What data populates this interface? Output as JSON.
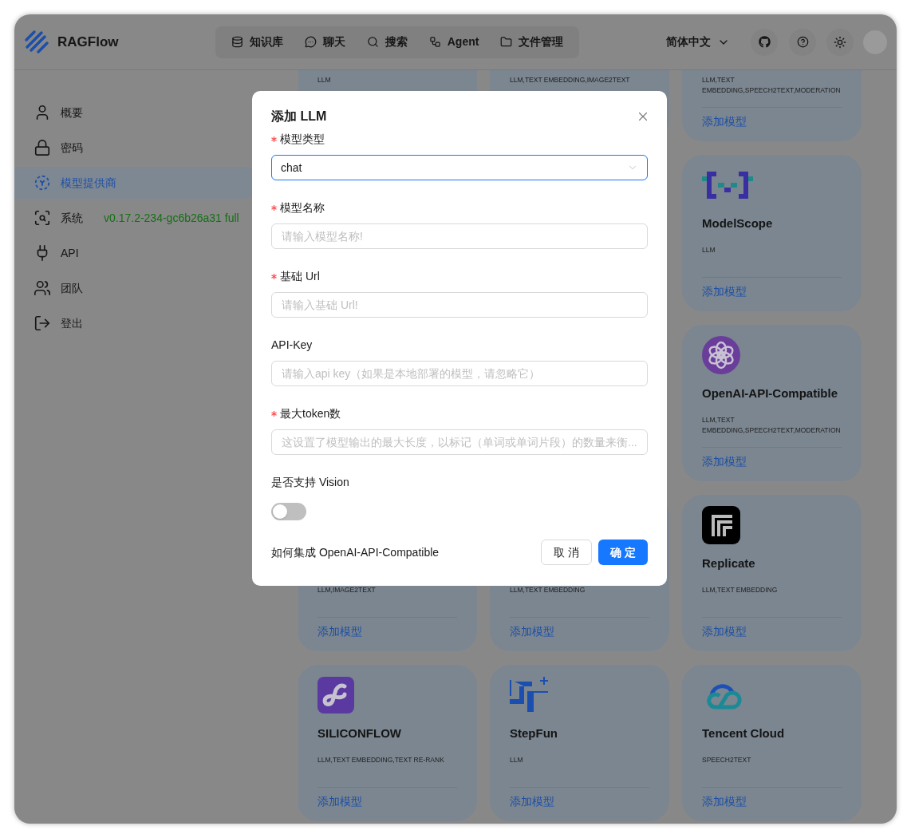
{
  "header": {
    "brand": "RAGFlow",
    "nav": [
      {
        "label": "知识库"
      },
      {
        "label": "聊天"
      },
      {
        "label": "搜索"
      },
      {
        "label": "Agent"
      },
      {
        "label": "文件管理"
      }
    ],
    "language": "简体中文"
  },
  "sidebar": {
    "items": [
      {
        "label": "概要",
        "selected": false
      },
      {
        "label": "密码",
        "selected": false
      },
      {
        "label": "模型提供商",
        "selected": true
      },
      {
        "label": "系统",
        "selected": false,
        "version": "v0.17.2-234-gc6b26a31 full"
      },
      {
        "label": "API",
        "selected": false
      },
      {
        "label": "团队",
        "selected": false
      },
      {
        "label": "登出",
        "selected": false
      }
    ]
  },
  "provider_rows": [
    {
      "cards": [
        {
          "tags": "LLM"
        },
        {
          "tags": "LLM,TEXT EMBEDDING,IMAGE2TEXT"
        },
        {
          "tags": "LLM,TEXT EMBEDDING,SPEECH2TEXT,MODERATION",
          "action": "添加模型"
        }
      ]
    },
    {
      "cards": [
        {
          "name": "ModelScope",
          "tags": "LLM",
          "action": "添加模型"
        }
      ]
    },
    {
      "cards": [
        {
          "name": "OpenAI-API-Compatible",
          "tags": "LLM,TEXT EMBEDDING,SPEECH2TEXT,MODERATION",
          "action": "添加模型"
        }
      ]
    },
    {
      "cards": [
        {
          "tags": "LLM,IMAGE2TEXT",
          "action": "添加模型"
        },
        {
          "tags": "LLM,TEXT EMBEDDING",
          "action": "添加模型"
        },
        {
          "name": "Replicate",
          "tags": "LLM,TEXT EMBEDDING",
          "action": "添加模型"
        }
      ]
    },
    {
      "cards": [
        {
          "name": "SILICONFLOW",
          "tags": "LLM,TEXT EMBEDDING,TEXT RE-RANK",
          "action": "添加模型"
        },
        {
          "name": "StepFun",
          "tags": "LLM",
          "action": "添加模型"
        },
        {
          "name": "Tencent Cloud",
          "tags": "SPEECH2TEXT",
          "action": "添加模型"
        }
      ]
    }
  ],
  "dialog": {
    "title": "添加 LLM",
    "fields": [
      {
        "kind": "select",
        "label": "模型类型",
        "required": true,
        "value": "chat"
      },
      {
        "kind": "input",
        "label": "模型名称",
        "required": true,
        "placeholder": "请输入模型名称!"
      },
      {
        "kind": "input",
        "label": "基础 Url",
        "required": true,
        "placeholder": "请输入基础 Url!"
      },
      {
        "kind": "input",
        "label": "API-Key",
        "required": false,
        "placeholder": "请输入api key（如果是本地部署的模型，请忽略它）"
      },
      {
        "kind": "input",
        "label": "最大token数",
        "required": true,
        "placeholder": "这设置了模型输出的最大长度，以标记（单词或单词片段）的数量来衡..."
      },
      {
        "kind": "switch",
        "label": "是否支持 Vision",
        "on": false
      }
    ],
    "help_link": "如何集成 OpenAI-API-Compatible",
    "buttons": [
      {
        "label": "取 消",
        "kind": "secondary"
      },
      {
        "label": "确 定",
        "kind": "primary"
      }
    ]
  }
}
